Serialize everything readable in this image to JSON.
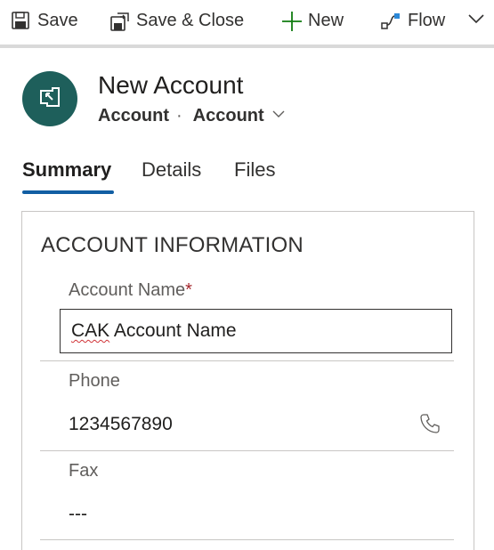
{
  "toolbar": {
    "save_label": "Save",
    "save_close_label": "Save & Close",
    "new_label": "New",
    "flow_label": "Flow"
  },
  "header": {
    "title": "New Account",
    "entity": "Account",
    "separator": "·",
    "form_name": "Account"
  },
  "tabs": [
    {
      "label": "Summary",
      "active": true
    },
    {
      "label": "Details",
      "active": false
    },
    {
      "label": "Files",
      "active": false
    }
  ],
  "section": {
    "title": "ACCOUNT INFORMATION",
    "fields": {
      "account_name": {
        "label": "Account Name",
        "required_marker": "*",
        "value_misspelled": "CAK",
        "value_rest": " Account Name"
      },
      "phone": {
        "label": "Phone",
        "value": "1234567890"
      },
      "fax": {
        "label": "Fax",
        "value": "---"
      }
    }
  },
  "colors": {
    "accent": "#115ea3",
    "avatar_bg": "#1e5f5b",
    "new_icon": "#107c10",
    "required": "#a4262c"
  }
}
